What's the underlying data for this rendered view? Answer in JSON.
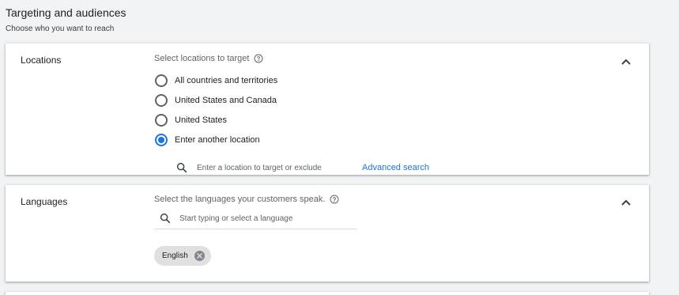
{
  "header": {
    "title": "Targeting and audiences",
    "subtitle": "Choose who you want to reach"
  },
  "locations": {
    "title": "Locations",
    "label": "Select locations to target",
    "options": [
      {
        "label": "All countries and territories",
        "checked": false
      },
      {
        "label": "United States and Canada",
        "checked": false
      },
      {
        "label": "United States",
        "checked": false
      },
      {
        "label": "Enter another location",
        "checked": true
      }
    ],
    "search_placeholder": "Enter a location to target or exclude",
    "advanced_search": "Advanced search"
  },
  "languages": {
    "title": "Languages",
    "label": "Select the languages your customers speak.",
    "search_placeholder": "Start typing or select a language",
    "selected": [
      "English"
    ]
  },
  "colors": {
    "accent": "#1a73e8",
    "background": "#f1f3f4",
    "card": "#ffffff"
  }
}
